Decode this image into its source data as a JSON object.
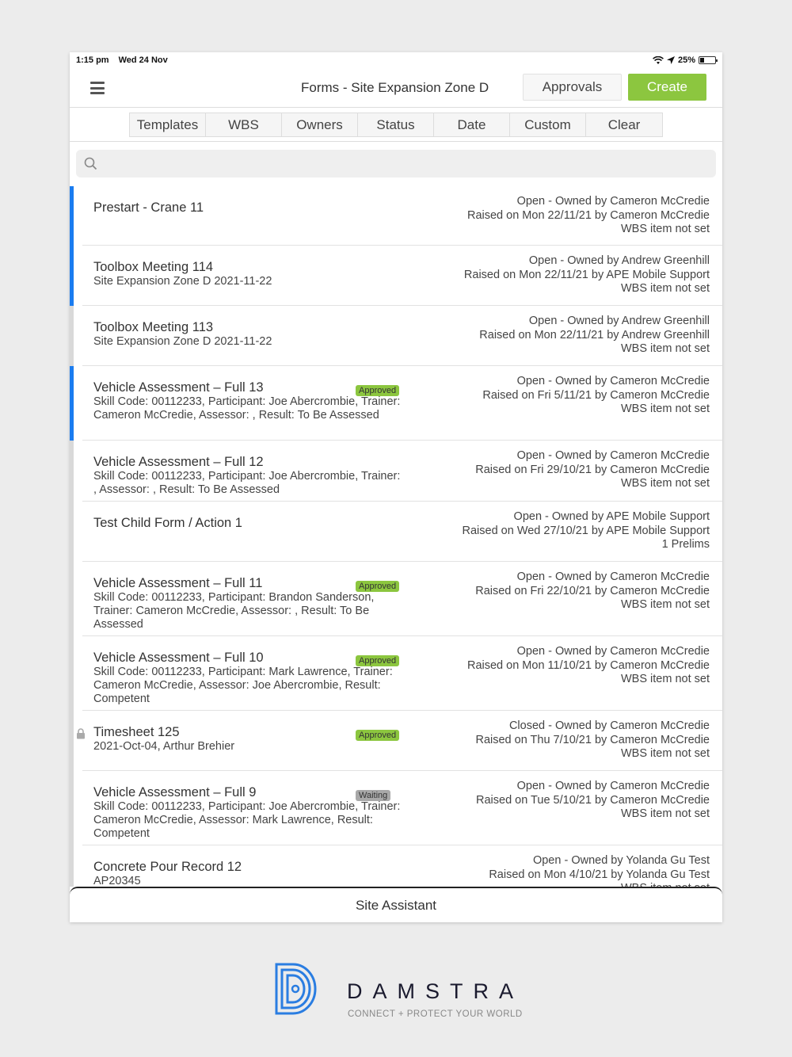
{
  "status_bar": {
    "time": "1:15 pm",
    "date": "Wed 24 Nov",
    "battery": "25%",
    "battery_level": 0.25
  },
  "header": {
    "title": "Forms - Site Expansion Zone D",
    "approvals_label": "Approvals",
    "create_label": "Create"
  },
  "filters": [
    "Templates",
    "WBS",
    "Owners",
    "Status",
    "Date",
    "Custom",
    "Clear"
  ],
  "search": {
    "placeholder": "",
    "value": ""
  },
  "colors": {
    "accent_green": "#8cc63f",
    "marker_blue": "#1a7cf0",
    "marker_grey": "#d9d9d9",
    "waiting_grey": "#a8a8a8"
  },
  "forms": [
    {
      "title": "Prestart - Crane 11",
      "subtitle": "",
      "badge": "",
      "status": "Open - Owned by Cameron McCredie",
      "raised": "Raised on Mon 22/11/21 by Cameron McCredie",
      "wbs": "WBS item not set",
      "marker": "blue",
      "locked": false
    },
    {
      "title": "Toolbox Meeting 114",
      "subtitle": "Site Expansion Zone D 2021-11-22",
      "badge": "",
      "status": "Open - Owned by Andrew Greenhill",
      "raised": "Raised on Mon 22/11/21 by APE Mobile Support",
      "wbs": "WBS item not set",
      "marker": "blue",
      "locked": false
    },
    {
      "title": "Toolbox Meeting 113",
      "subtitle": "Site Expansion Zone D 2021-11-22",
      "badge": "",
      "status": "Open - Owned by Andrew Greenhill",
      "raised": "Raised on Mon 22/11/21 by Andrew Greenhill",
      "wbs": "WBS item not set",
      "marker": "grey",
      "locked": false
    },
    {
      "title": "Vehicle Assessment – Full 13",
      "subtitle": "Skill Code: 00112233, Participant: Joe Abercrombie, Trainer: Cameron McCredie, Assessor: , Result: To Be Assessed",
      "badge": "Approved",
      "status": "Open - Owned by Cameron McCredie",
      "raised": "Raised on Fri 5/11/21 by Cameron McCredie",
      "wbs": "WBS item not set",
      "marker": "blue",
      "locked": false
    },
    {
      "title": "Vehicle Assessment – Full 12",
      "subtitle": "Skill Code: 00112233, Participant: Joe Abercrombie, Trainer: , Assessor: , Result: To Be Assessed",
      "badge": "",
      "status": "Open - Owned by Cameron McCredie",
      "raised": "Raised on Fri 29/10/21 by Cameron McCredie",
      "wbs": "WBS item not set",
      "marker": "grey",
      "locked": false
    },
    {
      "title": "Test Child Form / Action 1",
      "subtitle": "",
      "badge": "",
      "status": "Open - Owned by APE Mobile Support",
      "raised": "Raised on Wed 27/10/21 by APE Mobile Support",
      "wbs": "1 Prelims",
      "marker": "grey",
      "locked": false
    },
    {
      "title": "Vehicle Assessment – Full 11",
      "subtitle": "Skill Code: 00112233, Participant: Brandon Sanderson, Trainer: Cameron McCredie, Assessor: , Result: To Be Assessed",
      "badge": "Approved",
      "status": "Open - Owned by Cameron McCredie",
      "raised": "Raised on Fri 22/10/21 by Cameron McCredie",
      "wbs": "WBS item not set",
      "marker": "grey",
      "locked": false
    },
    {
      "title": "Vehicle Assessment – Full 10",
      "subtitle": "Skill Code: 00112233, Participant: Mark Lawrence, Trainer: Cameron McCredie, Assessor: Joe Abercrombie, Result: Competent",
      "badge": "Approved",
      "status": "Open - Owned by Cameron McCredie",
      "raised": "Raised on Mon 11/10/21 by Cameron McCredie",
      "wbs": "WBS item not set",
      "marker": "grey",
      "locked": false
    },
    {
      "title": "Timesheet 125",
      "subtitle": "2021-Oct-04, Arthur Brehier",
      "badge": "Approved",
      "status": "Closed - Owned by Cameron McCredie",
      "raised": "Raised on Thu 7/10/21 by Cameron McCredie",
      "wbs": "WBS item not set",
      "marker": "grey",
      "locked": true
    },
    {
      "title": "Vehicle Assessment – Full 9",
      "subtitle": "Skill Code: 00112233, Participant: Joe Abercrombie, Trainer: Cameron McCredie, Assessor: Mark Lawrence, Result: Competent",
      "badge": "Waiting",
      "status": "Open - Owned by Cameron McCredie",
      "raised": "Raised on Tue 5/10/21 by Cameron McCredie",
      "wbs": "WBS item not set",
      "marker": "grey",
      "locked": false
    },
    {
      "title": "Concrete Pour Record 12",
      "subtitle": "AP20345",
      "badge": "",
      "status": "Open - Owned by Yolanda Gu Test",
      "raised": "Raised on Mon 4/10/21 by Yolanda Gu Test",
      "wbs": "WBS item not set",
      "marker": "grey",
      "locked": false
    }
  ],
  "bottom_bar": {
    "label": "Site Assistant"
  },
  "branding": {
    "name": "DAMSTRA",
    "tagline": "CONNECT + PROTECT YOUR WORLD"
  }
}
